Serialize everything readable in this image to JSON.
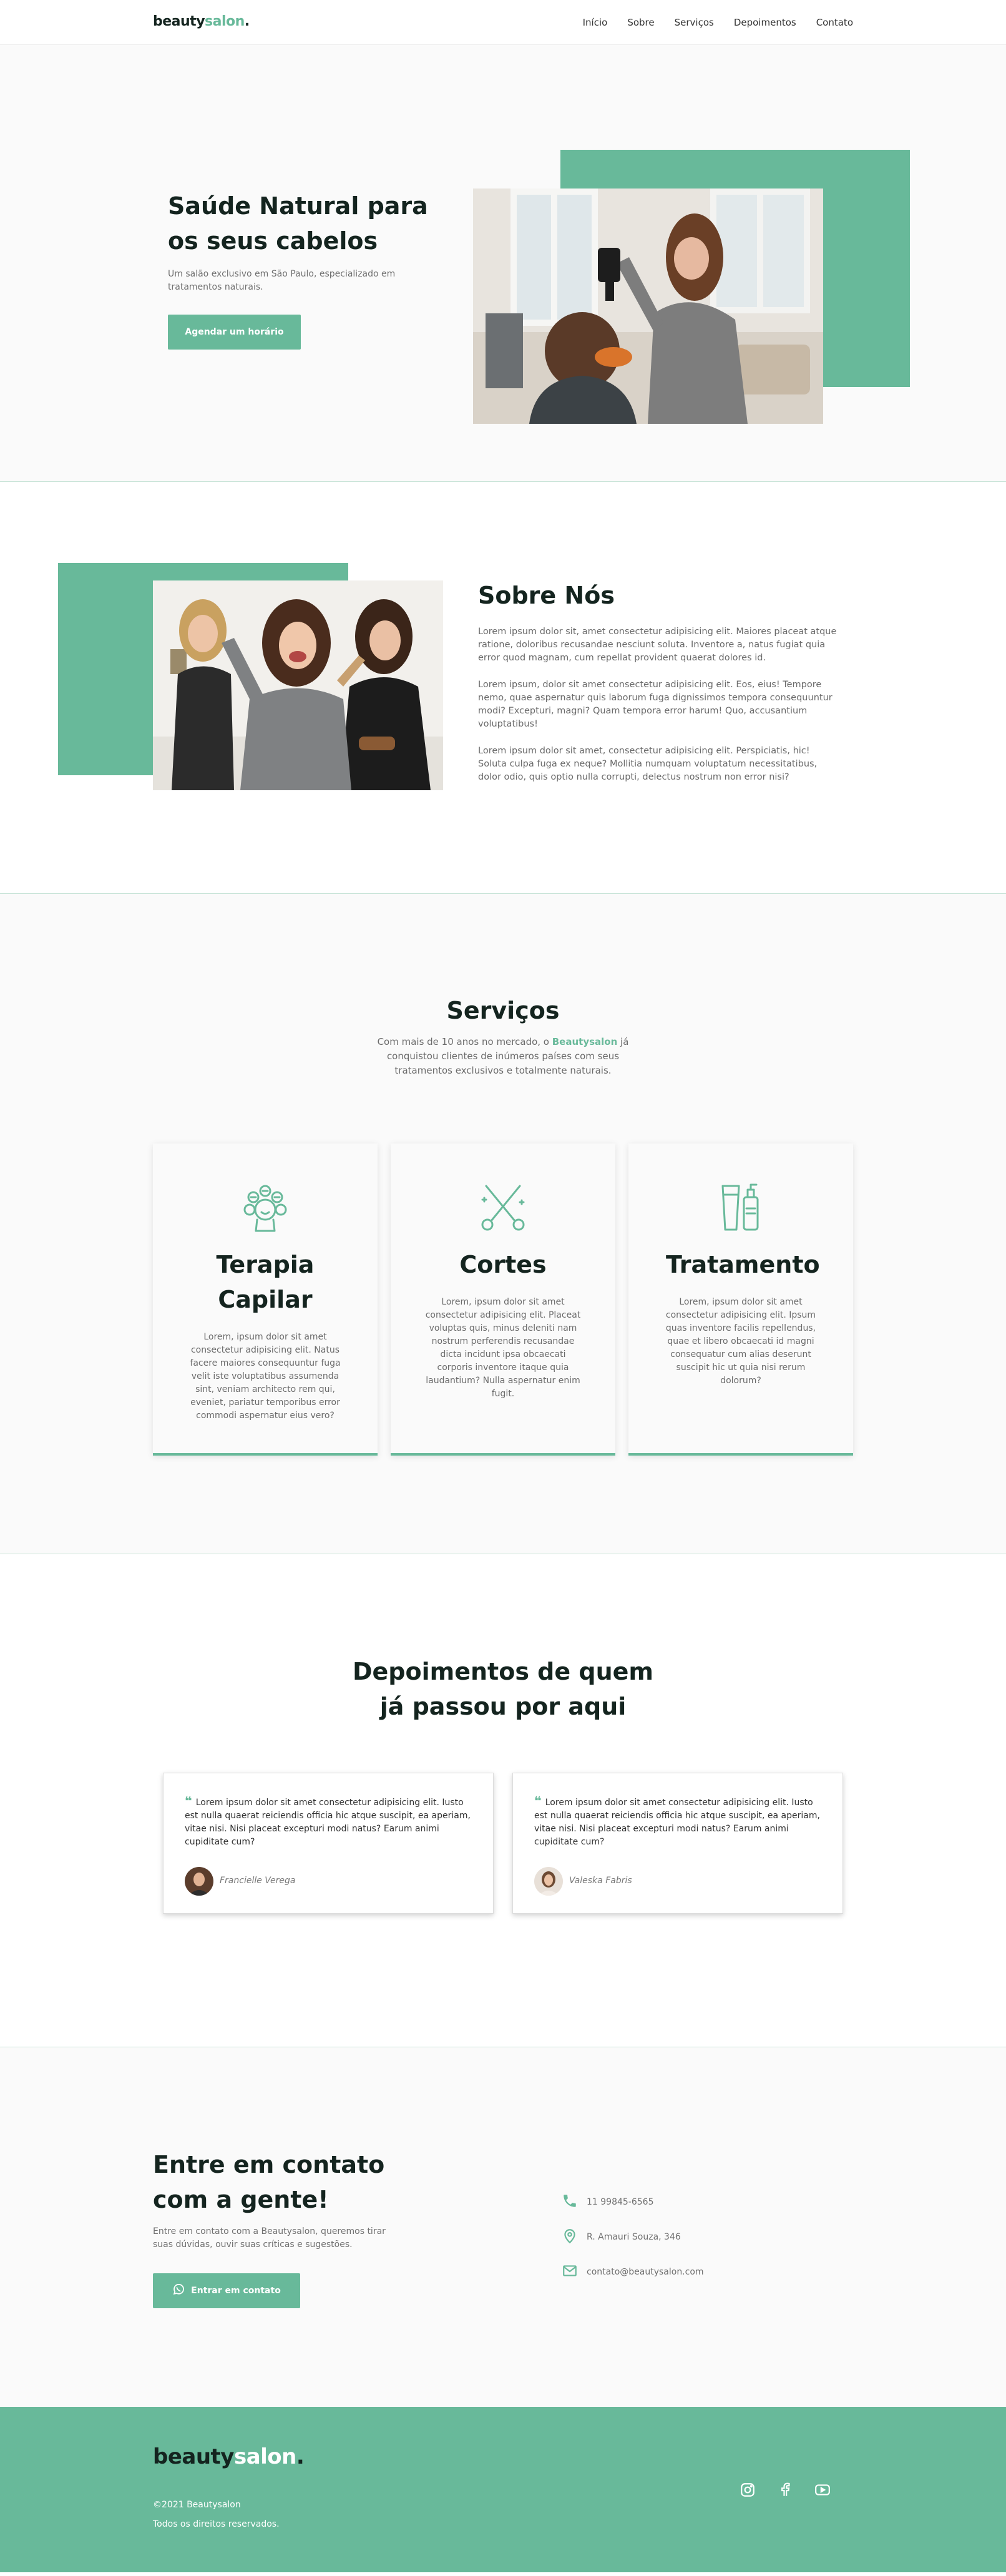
{
  "nav": {
    "logo_main": "beauty",
    "logo_accent": "salon",
    "logo_dot": ".",
    "items": [
      "Início",
      "Sobre",
      "Serviços",
      "Depoimentos",
      "Contato"
    ]
  },
  "hero": {
    "title": "Saúde Natural para os seus cabelos",
    "subtitle": "Um salão exclusivo em São Paulo, especializado em tratamentos naturais.",
    "cta": "Agendar um horário"
  },
  "about": {
    "title": "Sobre Nós",
    "paragraphs": [
      "Lorem ipsum dolor sit, amet consectetur adipisicing elit. Maiores placeat atque ratione, doloribus recusandae nesciunt soluta. Inventore a, natus fugiat quia error quod magnam, cum repellat provident quaerat dolores id.",
      "Lorem ipsum, dolor sit amet consectetur adipisicing elit. Eos, eius! Tempore nemo, quae aspernatur quis laborum fuga dignissimos tempora consequuntur modi? Excepturi, magni? Quam tempora error harum! Quo, accusantium voluptatibus!",
      "Lorem ipsum dolor sit amet, consectetur adipisicing elit. Perspiciatis, hic! Soluta culpa fuga ex neque? Mollitia numquam voluptatum necessitatibus, dolor odio, quis optio nulla corrupti, delectus nostrum non error nisi?"
    ]
  },
  "services": {
    "title": "Serviços",
    "intro_before": "Com mais de 10 anos no mercado, o ",
    "intro_brand": "Beautysalon",
    "intro_after": " já conquistou clientes de inúmeros países com seus tratamentos exclusivos e totalmente naturais.",
    "cards": [
      {
        "title": "Terapia Capilar",
        "icon": "hair-curlers-icon",
        "text": "Lorem, ipsum dolor sit amet consectetur adipisicing elit. Natus facere maiores consequuntur fuga velit iste voluptatibus assumenda sint, veniam architecto rem qui, eveniet, pariatur temporibus error commodi aspernatur eius vero?"
      },
      {
        "title": "Cortes",
        "icon": "scissors-comb-icon",
        "text": "Lorem, ipsum dolor sit amet consectetur adipisicing elit. Placeat voluptas quis, minus deleniti nam nostrum perferendis recusandae dicta incidunt ipsa obcaecati corporis inventore itaque quia laudantium? Nulla aspernatur enim fugit."
      },
      {
        "title": "Tratamento",
        "icon": "cosmetics-bottles-icon",
        "text": "Lorem, ipsum dolor sit amet consectetur adipisicing elit. Ipsum quas inventore facilis repellendus, quae et libero obcaecati id magni consequatur cum alias deserunt suscipit hic ut quia nisi rerum dolorum?"
      }
    ]
  },
  "testimonials": {
    "title": "Depoimentos de quem já passou por aqui",
    "quote_mark": "❝",
    "items": [
      {
        "quote": "Lorem ipsum dolor sit amet consectetur adipisicing elit. Iusto est nulla quaerat reiciendis officia hic atque suscipit, ea aperiam, vitae nisi. Nisi placeat excepturi modi natus? Earum animi cupiditate cum?",
        "name": "Francielle Verega"
      },
      {
        "quote": "Lorem ipsum dolor sit amet consectetur adipisicing elit. Iusto est nulla quaerat reiciendis officia hic atque suscipit, ea aperiam, vitae nisi. Nisi placeat excepturi modi natus? Earum animi cupiditate cum?",
        "name": "Valeska Fabris"
      }
    ]
  },
  "contact": {
    "title": "Entre em contato com a gente!",
    "subtitle": "Entre em contato com a Beautysalon, queremos tirar suas dúvidas, ouvir suas críticas e sugestões.",
    "cta": "Entrar em contato",
    "phone": "11 99845-6565",
    "address": "R. Amauri Souza, 346",
    "email": "contato@beautysalon.com"
  },
  "footer": {
    "logo_main": "beauty",
    "logo_accent": "salon",
    "logo_dot": ".",
    "copyright": "©2021 Beautysalon",
    "rights": "Todos os direitos reservados."
  },
  "colors": {
    "accent": "#68b99a",
    "dark": "#14241f",
    "muted": "#6b6b6b",
    "section_bg": "#fafafa"
  }
}
